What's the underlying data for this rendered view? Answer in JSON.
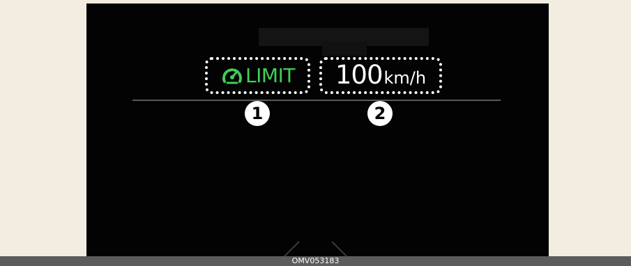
{
  "display": {
    "limit_label": "LIMIT",
    "limit_icon": "speed-limiter-icon",
    "speed_value": "100",
    "speed_unit": "km/h"
  },
  "callouts": {
    "first": "1",
    "second": "2"
  },
  "caption": "OMV053183",
  "colors": {
    "limit_green": "#3fcf57",
    "screen_background": "#030303",
    "page_background": "#f3ece1",
    "caption_bar": "#5c5c5c"
  }
}
